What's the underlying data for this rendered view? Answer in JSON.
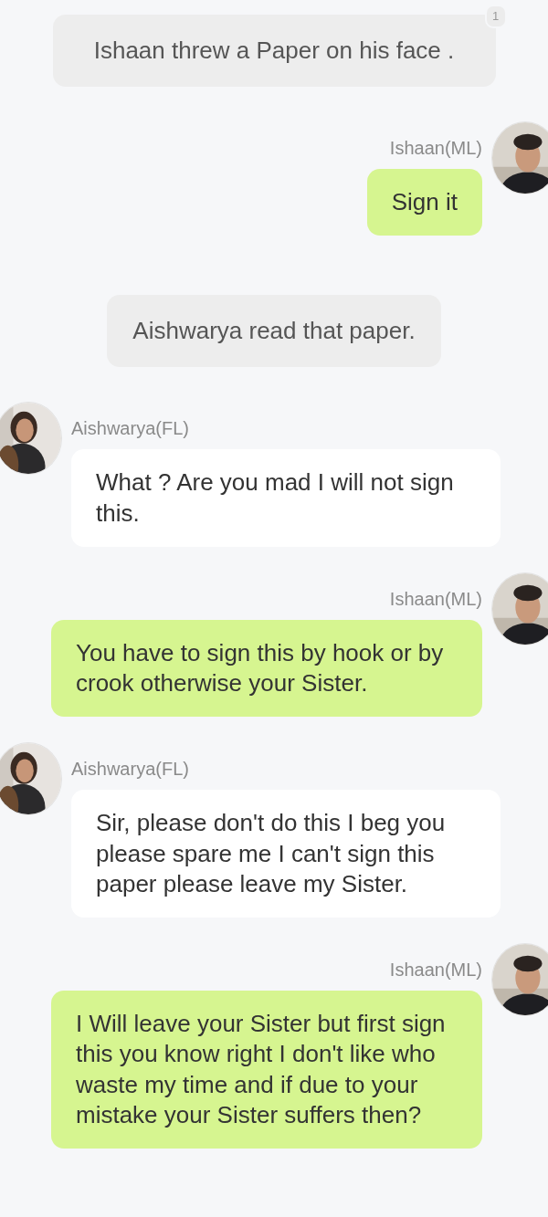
{
  "messages": [
    {
      "kind": "narration",
      "text": "Ishaan threw a Paper on his face .",
      "badge": "1"
    },
    {
      "kind": "right",
      "sender": "Ishaan(ML)",
      "text": "Sign it"
    },
    {
      "kind": "narration",
      "text": "Aishwarya read that paper."
    },
    {
      "kind": "left",
      "sender": "Aishwarya(FL)",
      "text": "What ? Are you mad I will not sign this."
    },
    {
      "kind": "right",
      "sender": "Ishaan(ML)",
      "text": "You have to sign this by hook or by crook otherwise your Sister."
    },
    {
      "kind": "left",
      "sender": "Aishwarya(FL)",
      "text": "Sir, please don't do this I beg you please spare me I can't sign this paper please leave my Sister."
    },
    {
      "kind": "right",
      "sender": "Ishaan(ML)",
      "text": "I Will leave your Sister but first sign this you know right I don't like who waste my time and if due to your mistake your Sister suffers then?"
    }
  ]
}
